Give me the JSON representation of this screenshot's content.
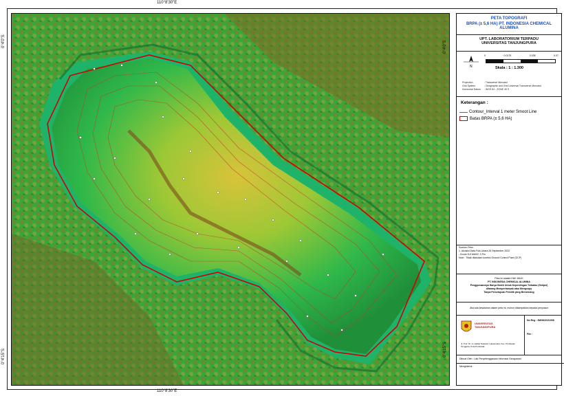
{
  "coords": {
    "top_lon": "110°8'30\"E",
    "bottom_lon": "110°8'30\"E",
    "left_lat_top": "0°4'0\"S",
    "left_lat_bottom": "0°4'15\"S",
    "right_lat_top": "0°4'0\"S",
    "right_lat_bottom": "0°4'15\"S"
  },
  "title": {
    "line1": "PETA TOPOGRAFI",
    "line2": "BRPA (± 5,6 HA) PT. INDONESIA CHEMICAL ALUMINA"
  },
  "institution": {
    "line1": "UPT. LABORATORIUM TERPADU",
    "line2": "UNIVERSITAS TANJUNGPURA"
  },
  "scale": {
    "ticks": [
      "0",
      "0.0175",
      "0.035",
      "0.07"
    ],
    "label": "Skala : 1 : 1.300"
  },
  "projection": [
    {
      "k": "Projection",
      "v": ": Transverse Mercator"
    },
    {
      "k": "Grid System",
      "v": ": Geographic and Grid Universal Transverse Mercator"
    },
    {
      "k": "Horizontal Datum",
      "v": ": WGS 84 - ZONE 49 S"
    }
  ],
  "legend": {
    "title": "Keterangan :",
    "contour": "Contour_Interval 1 meter Smoot Line",
    "boundary": "Batas BRPA  (± 5,6 HA)"
  },
  "source": {
    "title": "Sumber Peta :",
    "l1": "1. Akuisisi Data Foto Udara 26 September 2022",
    "l2": "- Drone DJI MAVIC 3 Pro",
    "note": "Note : Tidak dilakukan koreksi Ground Control Point (GCP)"
  },
  "owner": {
    "l1": "Peta ini adalah HAK MILIK",
    "l2": "PT. INDONESIA CHEMICAL ALUMINA",
    "l3": "Penggunaannya Hanya Boleh Untuk Kepentingan Terbatas (Skripsi)",
    "l4": "dilarang Memperbanyak atau Mengcopy",
    "l5": "Tanpa Persetujuan Pemilik yang Berwenang"
  },
  "warning": "Jika ada kesalahan dalam peta ini, mohon disampaikan kepada penyusun",
  "uni_name": {
    "l1": "UNIVERSITAS",
    "l2": "TANJUNGPURA"
  },
  "address": "Jl. Prof. Dr. H. Hadari Nawawi, Laksamana, Kec. Pontianak Tenggara, Kota Pontianak",
  "reg_label": "No Reg : 2M/0622/21008",
  "file_label": "File :",
  "made_by": "Dibuat Oleh : Lab Penyelenggaraan Informasi Geospasial",
  "checked_by": "Mengetahui :",
  "colors": {
    "title_blue": "#1a4fc0",
    "boundary_red": "#d10000",
    "contour": "#c0392b"
  }
}
